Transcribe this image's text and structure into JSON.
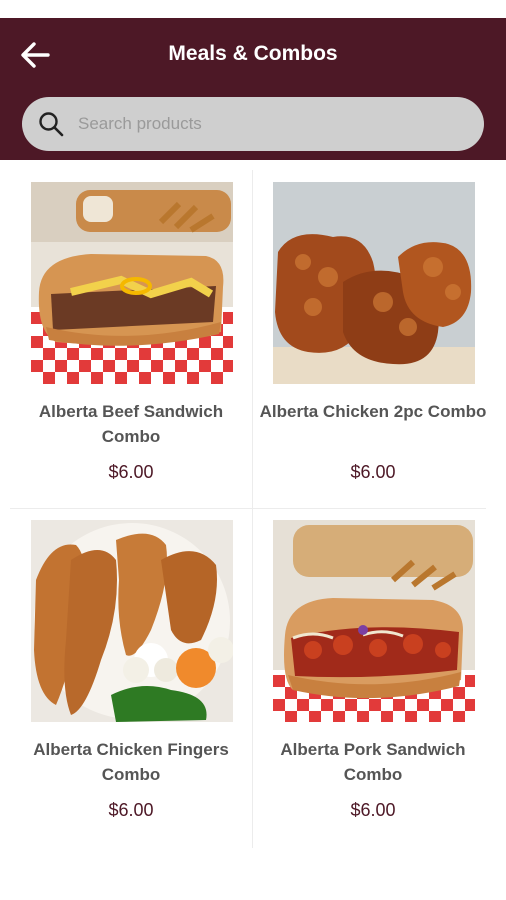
{
  "header": {
    "title": "Meals & Combos",
    "background_color": "#4d1826",
    "back_icon": "arrow-left-icon"
  },
  "search": {
    "placeholder": "Search products",
    "icon": "search-icon"
  },
  "products": [
    {
      "name": "Alberta Beef Sandwich Combo",
      "price": "$6.00"
    },
    {
      "name": "Alberta Chicken 2pc Combo",
      "price": "$6.00"
    },
    {
      "name": "Alberta Chicken Fingers Combo",
      "price": "$6.00"
    },
    {
      "name": "Alberta Pork Sandwich Combo",
      "price": "$6.00"
    }
  ]
}
